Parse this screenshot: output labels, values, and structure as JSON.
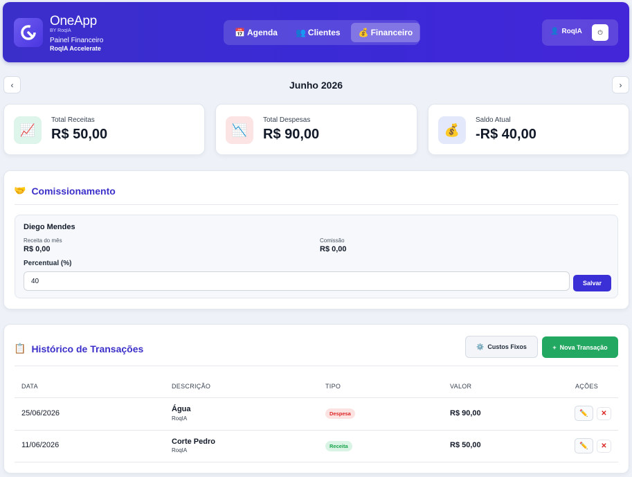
{
  "header": {
    "brand": "OneApp",
    "by": "BY RoqIA",
    "subtitle": "Painel Financeiro",
    "subtitle2": "RoqIA Accelerate",
    "nav": [
      {
        "icon": "📅",
        "label": "Agenda"
      },
      {
        "icon": "👥",
        "label": "Clientes"
      },
      {
        "icon": "💰",
        "label": "Financeiro"
      }
    ],
    "active_nav": "Financeiro",
    "user": {
      "icon": "👤",
      "name": "RoqIA",
      "power_icon": "⏻"
    }
  },
  "month": {
    "prev": "‹",
    "next": "›",
    "title": "Junho 2026"
  },
  "stats": [
    {
      "icon": "📈",
      "label": "Total Receitas",
      "value": "R$ 50,00"
    },
    {
      "icon": "📉",
      "label": "Total Despesas",
      "value": "R$ 90,00"
    },
    {
      "icon": "💰",
      "label": "Saldo Atual",
      "value": "-R$ 40,00"
    }
  ],
  "commission": {
    "icon": "🤝",
    "title": "Comissionamento",
    "employee": "Diego Mendes",
    "revenue_label": "Receita do mês",
    "revenue_value": "R$ 0,00",
    "commission_label": "Comissão",
    "commission_value": "R$ 0,00",
    "percent_label": "Percentual (%)",
    "percent_value": "40",
    "save_label": "Salvar"
  },
  "transactions": {
    "icon": "📋",
    "title": "Histórico de Transações",
    "fixed_costs": {
      "icon": "⚙️",
      "label": "Custos Fixos"
    },
    "new_transaction": {
      "icon": "+",
      "label": "Nova Transação"
    },
    "columns": [
      "DATA",
      "DESCRIÇÃO",
      "TIPO",
      "VALOR",
      "AÇÕES"
    ],
    "rows": [
      {
        "date": "25/06/2026",
        "desc": "Água",
        "sub": "RoqIA",
        "type": "Despesa",
        "value": "R$ 90,00",
        "edit": "✏️",
        "delete": "✕"
      },
      {
        "date": "11/06/2026",
        "desc": "Corte Pedro",
        "sub": "RoqIA",
        "type": "Receita",
        "value": "R$ 50,00",
        "edit": "✏️",
        "delete": "✕"
      }
    ]
  },
  "colors": {
    "primary": "#3b2fc9",
    "success": "#22a861",
    "danger": "#dc2626"
  }
}
